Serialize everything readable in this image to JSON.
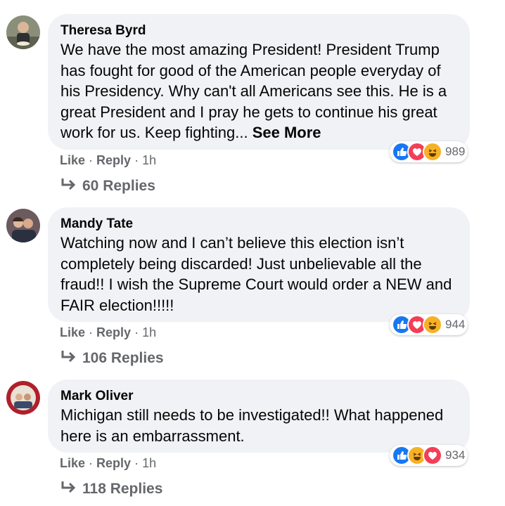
{
  "comments": [
    {
      "author": "Theresa Byrd",
      "text": "We have the most amazing President! President Trump has fought for good of the American people everyday of his Presidency. Why can't all Americans see this. He is a great President and I pray he gets to continue his great work for us. Keep fighting... ",
      "see_more": "See More",
      "like": "Like",
      "reply": "Reply",
      "time": "1h",
      "reaction_count": "989",
      "reactions": [
        "like-icon",
        "love-icon",
        "haha-icon"
      ],
      "replies": "60 Replies"
    },
    {
      "author": "Mandy Tate",
      "text": "Watching now and I can’t believe this election isn’t completely being discarded! Just unbelievable all the fraud!! I wish the Supreme Court would order a NEW and FAIR election!!!!!",
      "like": "Like",
      "reply": "Reply",
      "time": "1h",
      "reaction_count": "944",
      "reactions": [
        "like-icon",
        "love-icon",
        "haha-icon"
      ],
      "replies": "106 Replies"
    },
    {
      "author": "Mark Oliver",
      "text": "Michigan still needs to be investigated!! What happened here is an embarrassment.",
      "like": "Like",
      "reply": "Reply",
      "time": "1h",
      "reaction_count": "934",
      "reactions": [
        "like-icon",
        "haha-icon",
        "love-icon"
      ],
      "replies": "118 Replies"
    }
  ],
  "colors": {
    "bubble": "#f0f2f5",
    "secondary_text": "#65676b",
    "like_blue": "#1877f2",
    "love_red": "#f33e58",
    "haha_yellow": "#f7b125"
  }
}
